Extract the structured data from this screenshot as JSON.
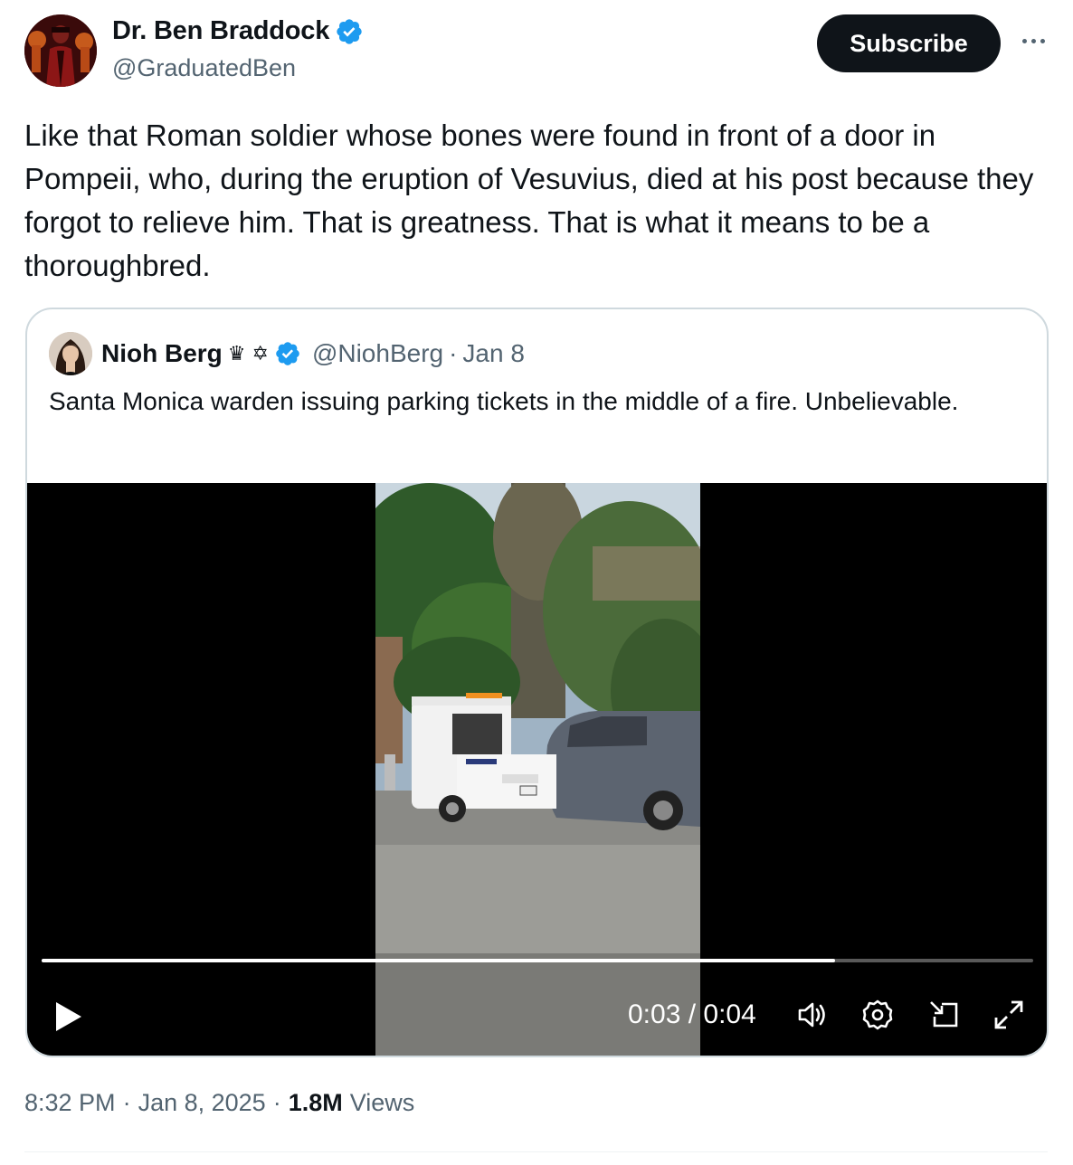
{
  "author": {
    "name": "Dr. Ben Braddock",
    "handle": "@GraduatedBen",
    "verified": true
  },
  "subscribe_label": "Subscribe",
  "tweet_text": "Like that Roman soldier whose bones were found in front of a door in Pompeii, who, during the eruption of Vesuvius, died at his post because they forgot to relieve him. That is greatness. That is what it means to be a thoroughbred.",
  "quoted": {
    "name": "Nioh Berg",
    "emojis": "♛ ✡",
    "handle": "@NiohBerg",
    "dot": "·",
    "date": "Jan 8",
    "text": "Santa Monica warden issuing parking tickets in the middle of a fire. Unbelievable.",
    "video": {
      "current_time": "0:03",
      "duration": "0:04",
      "time_display": "0:03 / 0:04",
      "progress_fraction": 0.8
    }
  },
  "meta": {
    "time": "8:32 PM",
    "sep": "·",
    "date": "Jan 8, 2025",
    "views_count": "1.8M",
    "views_label": "Views"
  },
  "colors": {
    "verified_blue": "#1d9bf0",
    "text_primary": "#0f1419",
    "text_secondary": "#536471",
    "border": "#cfd9de"
  },
  "icons": [
    "verified-badge-icon",
    "more-icon",
    "play-icon",
    "volume-icon",
    "settings-icon",
    "pip-icon",
    "fullscreen-icon"
  ]
}
